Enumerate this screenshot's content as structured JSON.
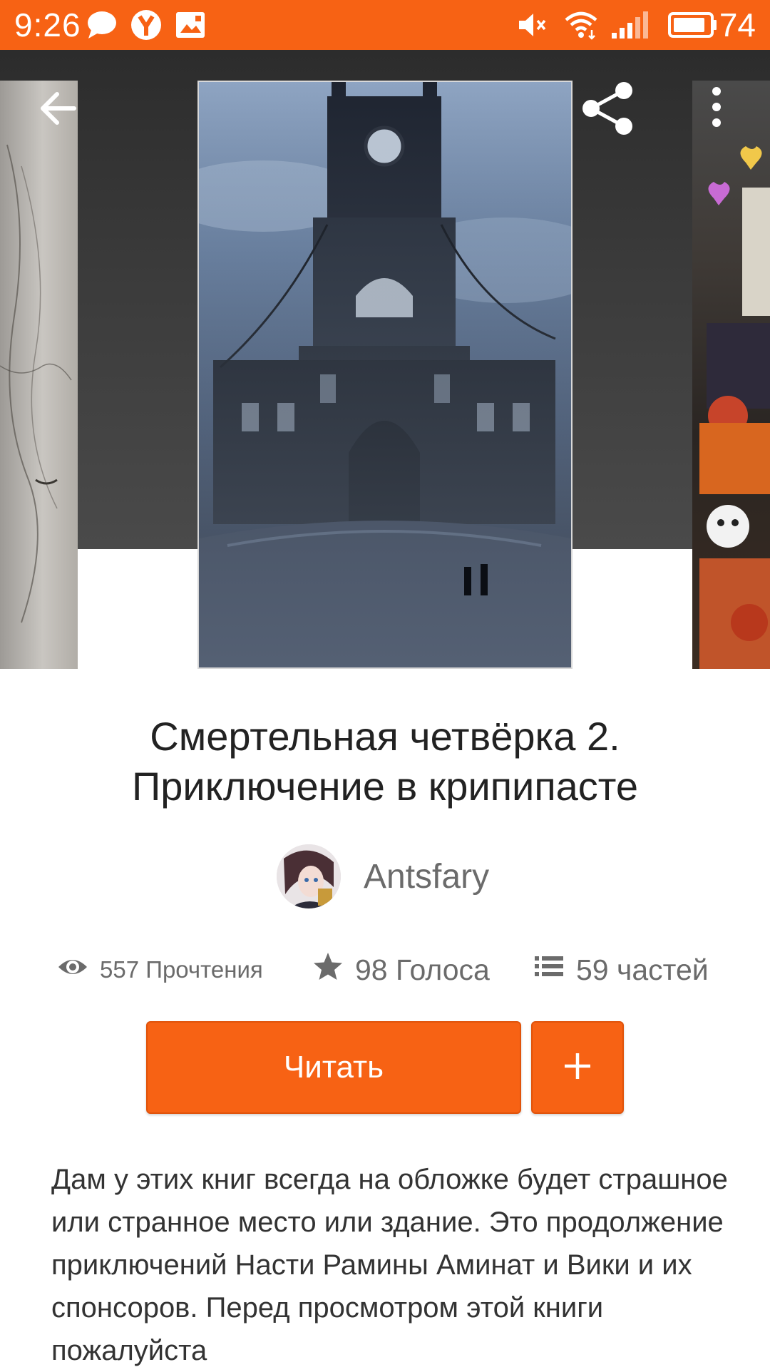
{
  "status_bar": {
    "time": "9:26",
    "battery_percent": "74",
    "icons": [
      "chat-bubble-icon",
      "yandex-icon",
      "image-icon",
      "mute-icon",
      "wifi-icon",
      "signal-icon",
      "battery-icon"
    ]
  },
  "header": {
    "back_icon": "arrow-left-icon",
    "share_icon": "share-icon",
    "menu_icon": "more-vertical-icon"
  },
  "story": {
    "title_line1": "Смертельная четвёрка 2.",
    "title_line2": "Приключение в крипипасте",
    "author": "Antsfary",
    "stats": {
      "reads": "557 Прочтения",
      "votes": "98 Голоса",
      "parts": "59 частей"
    },
    "read_button": "Читать",
    "description": "Дам у этих книг всегда на обложке будет страшное или странное место или здание. Это продолжение приключений Насти Рамины Аминат и Вики и их спонсоров. Перед просмотром этой книги пожалуйста"
  },
  "colors": {
    "accent": "#f76214",
    "stat_text": "#6b6b6b"
  }
}
